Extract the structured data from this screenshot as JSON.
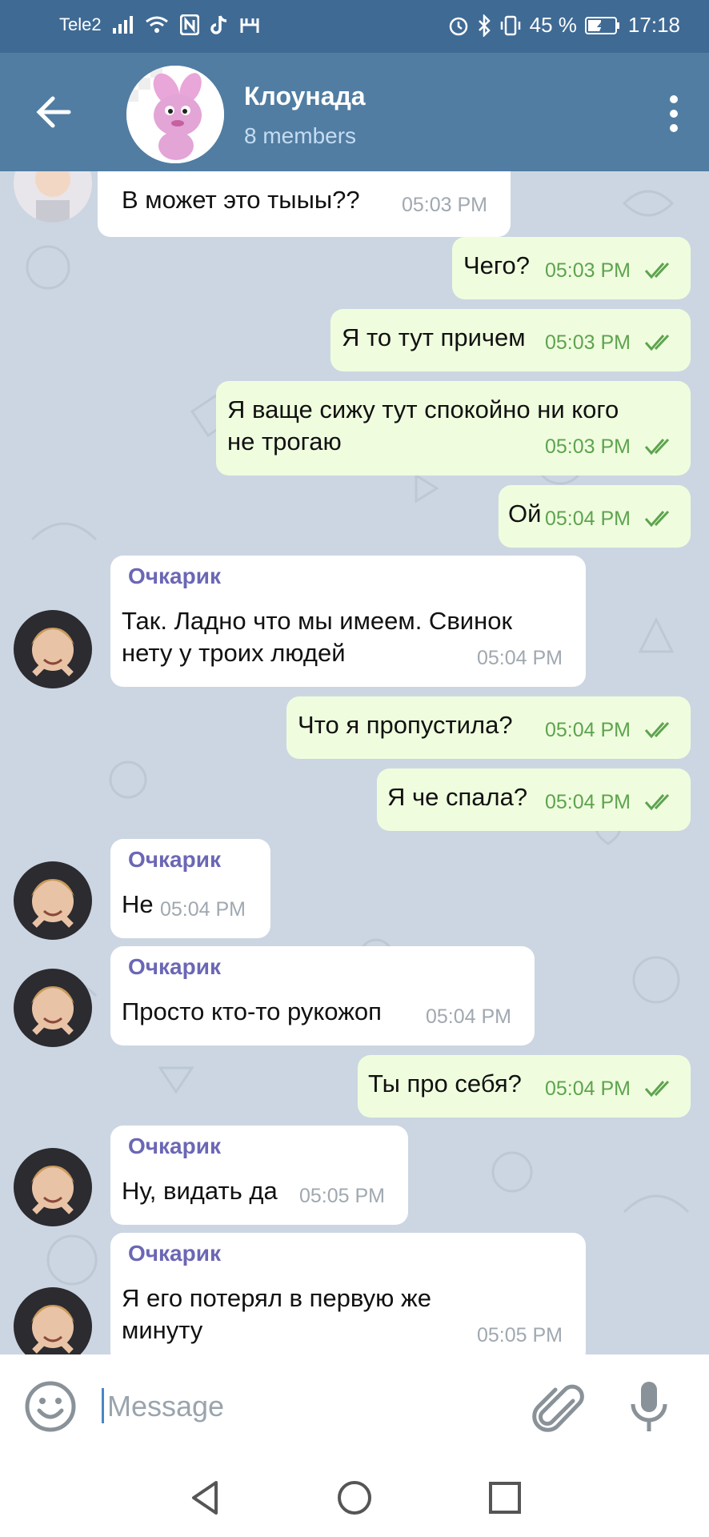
{
  "status_bar": {
    "carrier": "Tele2",
    "battery": "45 %",
    "time": "17:18"
  },
  "header": {
    "title": "Клоунада",
    "subtitle": "8 members"
  },
  "messages": [
    {
      "dir": "in",
      "sender": "",
      "text": "В может это тыыы??",
      "time": "05:03 PM"
    },
    {
      "dir": "out",
      "text": "Чего?",
      "time": "05:03 PM"
    },
    {
      "dir": "out",
      "text": "Я то тут причем",
      "time": "05:03 PM"
    },
    {
      "dir": "out",
      "text": "Я ваще сижу тут спокойно ни кого\nне трогаю",
      "time": "05:03 PM"
    },
    {
      "dir": "out",
      "text": "Ой",
      "time": "05:04 PM"
    },
    {
      "dir": "in",
      "sender": "Очкарик",
      "text": "Так. Ладно что мы имеем. Свинок\nнету у троих людей",
      "time": "05:04 PM"
    },
    {
      "dir": "out",
      "text": "Что я пропустила?",
      "time": "05:04 PM"
    },
    {
      "dir": "out",
      "text": "Я че спала?",
      "time": "05:04 PM"
    },
    {
      "dir": "in",
      "sender": "Очкарик",
      "text": "Не",
      "time": "05:04 PM"
    },
    {
      "dir": "in",
      "sender": "Очкарик",
      "text": "Просто кто-то рукожоп",
      "time": "05:04 PM"
    },
    {
      "dir": "out",
      "text": "Ты про себя?",
      "time": "05:04 PM"
    },
    {
      "dir": "in",
      "sender": "Очкарик",
      "text": "Ну, видать да",
      "time": "05:05 PM"
    },
    {
      "dir": "in",
      "sender": "Очкарик",
      "text": "Я его потерял в первую же\nминуту",
      "time": "05:05 PM"
    }
  ],
  "input": {
    "placeholder": "Message"
  },
  "colors": {
    "header_bg": "#517da2",
    "statusbar_bg": "#3f6a94",
    "chat_bg": "#ccd6e2",
    "bubble_out": "#effdde",
    "bubble_in": "#ffffff",
    "sender_name": "#6b67b5",
    "tick_green": "#5ea34f"
  },
  "icons": {
    "back": "arrow-left-icon",
    "menu": "more-vertical-icon",
    "emoji": "smile-icon",
    "attach": "paperclip-icon",
    "mic": "microphone-icon"
  }
}
